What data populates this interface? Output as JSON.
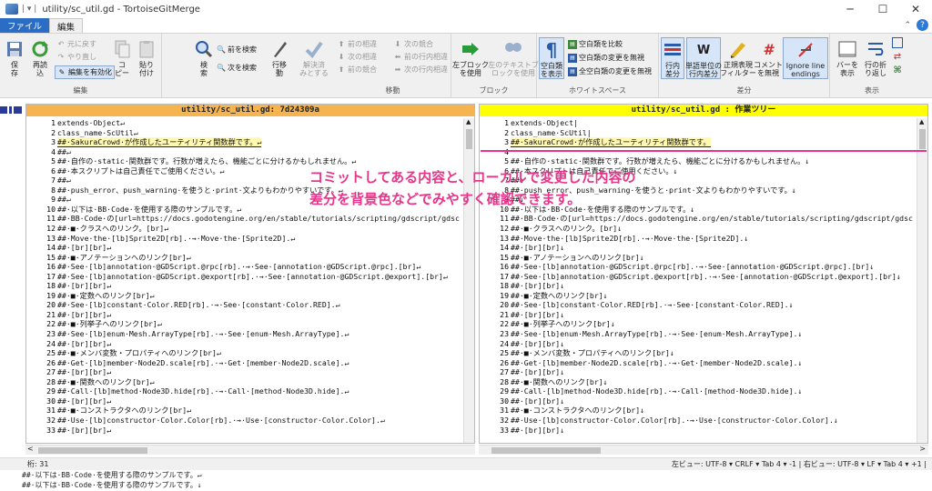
{
  "title": {
    "quick_access": "|  ▾ |",
    "text": "utility/sc_util.gd - TortoiseGitMerge"
  },
  "window_buttons": [
    "─",
    "☐",
    "✕"
  ],
  "tabs": {
    "file": "ファイル",
    "edit": "編集"
  },
  "ribbon": {
    "edit_group": {
      "label": "編集",
      "save": "保\n存",
      "reload": "再読\n込",
      "undo": "元に戻す",
      "redo": "やり直し",
      "enable_edit": "編集を有効化",
      "copy": "コ\nピー",
      "paste": "貼り\n付け"
    },
    "search_group": {
      "search": "検\n索",
      "find_prev": "前を検索",
      "find_next": "次を検索",
      "goto_line": "行移\n動",
      "resolve": "解決済\nみとする"
    },
    "move_group": {
      "label": "移動",
      "prev_diff": "前の相違",
      "next_diff": "次の相違",
      "prev_conflict_small": "前の競合",
      "prev_conflict": "前の競合",
      "next_conflict": "次の競合",
      "prev_inline": "前の行内相違",
      "next_inline": "次の行内相違"
    },
    "block_group": {
      "label": "ブロック",
      "use_left": "左ブロック\nを使用",
      "use_left_text": "左のテキストブ\nロックを使用"
    },
    "whitespace_group": {
      "label": "ホワイトスペース",
      "show_ws": "空白類\nを表示",
      "compare_ws": "空白類を比較",
      "ignore_ws_change": "空白類の変更を無視",
      "ignore_all_ws": "全空白類の変更を無視"
    },
    "diff_group": {
      "label": "差分",
      "line_diff": "行内\n差分",
      "word_diff": "単語単位の\n行内差分",
      "regex_filter": "正規表現\nフィルター",
      "ignore_comments": "コメント\nを無視",
      "ignore_line_endings": "Ignore line\nendings"
    },
    "view_group": {
      "label": "表示",
      "bars": "バーを\n表示",
      "wrap": "行の折\nり返し"
    }
  },
  "left_pane": {
    "header": "utility/sc_util.gd: 7d24309a",
    "header_color": "#f5b450",
    "lines": [
      {
        "n": "1",
        "t": "extends·Object↵"
      },
      {
        "n": "2",
        "t": "class_name·ScUtil↵"
      },
      {
        "n": "3",
        "t": "##·SakuraCrowd·が作成したユーティリティ関数群です。↵",
        "hl": true
      },
      {
        "n": "4",
        "t": "##↵"
      },
      {
        "n": "5",
        "t": "##·自作の·static·関数群です。行数が増えたら、機能ごとに分けるかもしれません。↵"
      },
      {
        "n": "6",
        "t": "##·本スクリプトは自己責任でご使用ください。↵"
      },
      {
        "n": "7",
        "t": "##↵"
      },
      {
        "n": "8",
        "t": "##·push_error、push_warning·を使うと·print·文よりもわかりやすいです。↵"
      },
      {
        "n": "9",
        "t": "##↵"
      },
      {
        "n": "10",
        "t": "##·以下は·BB·Code·を使用する際のサンプルです。↵"
      },
      {
        "n": "11",
        "t": "##·BB·Code·の[url=https://docs.godotengine.org/en/stable/tutorials/scripting/gdscript/gdsc"
      },
      {
        "n": "12",
        "t": "##·■·クラスへのリンク。[br]↵"
      },
      {
        "n": "13",
        "t": "##·Move·the·[lb]Sprite2D[rb].·→·Move·the·[Sprite2D].↵"
      },
      {
        "n": "14",
        "t": "##·[br][br]↵"
      },
      {
        "n": "15",
        "t": "##·■·アノテーションへのリンク[br]↵"
      },
      {
        "n": "16",
        "t": "##·See·[lb]annotation·@GDScript.@rpc[rb].·→·See·[annotation·@GDScript.@rpc].[br]↵"
      },
      {
        "n": "17",
        "t": "##·See·[lb]annotation·@GDScript.@export[rb].·→·See·[annotation·@GDScript.@export].[br]↵"
      },
      {
        "n": "18",
        "t": "##·[br][br]↵"
      },
      {
        "n": "19",
        "t": "##·■·定数へのリンク[br]↵"
      },
      {
        "n": "20",
        "t": "##·See·[lb]constant·Color.RED[rb].·→·See·[constant·Color.RED].↵"
      },
      {
        "n": "21",
        "t": "##·[br][br]↵"
      },
      {
        "n": "22",
        "t": "##·■·列挙子へのリンク[br]↵"
      },
      {
        "n": "23",
        "t": "##·See·[lb]enum·Mesh.ArrayType[rb].·→·See·[enum·Mesh.ArrayType].↵"
      },
      {
        "n": "24",
        "t": "##·[br][br]↵"
      },
      {
        "n": "25",
        "t": "##·■·メンバ変数・プロパティへのリンク[br]↵"
      },
      {
        "n": "26",
        "t": "##·Get·[lb]member·Node2D.scale[rb].·→·Get·[member·Node2D.scale].↵"
      },
      {
        "n": "27",
        "t": "##·[br][br]↵"
      },
      {
        "n": "28",
        "t": "##·■·関数へのリンク[br]↵"
      },
      {
        "n": "29",
        "t": "##·Call·[lb]method·Node3D.hide[rb].·→·Call·[method·Node3D.hide].↵"
      },
      {
        "n": "30",
        "t": "##·[br][br]↵"
      },
      {
        "n": "31",
        "t": "##·■·コンストラクタへのリンク[br]↵"
      },
      {
        "n": "32",
        "t": "##·Use·[lb]constructor·Color.Color[rb].·→·Use·[constructor·Color.Color].↵"
      },
      {
        "n": "33",
        "t": "##·[br][br]↵"
      }
    ]
  },
  "right_pane": {
    "header": "utility/sc_util.gd : 作業ツリー",
    "header_color": "#ffff00",
    "lines": [
      {
        "n": "1",
        "t": "extends·Object|"
      },
      {
        "n": "2",
        "t": "class_name·ScUtil|"
      },
      {
        "n": "3",
        "t": "##·SakuraCrowd·が作成したユーティリティ関数群です。",
        "hl": true
      },
      {
        "n": "4",
        "t": ""
      },
      {
        "n": "5",
        "t": "##·自作の·static·関数群です。行数が増えたら、機能ごとに分けるかもしれません。↓"
      },
      {
        "n": "6",
        "t": "##·本スクリプトは自己責任でご使用ください。↓"
      },
      {
        "n": "7",
        "t": "##↓"
      },
      {
        "n": "8",
        "t": "##·push_error、push_warning·を使うと·print·文よりもわかりやすいです。↓"
      },
      {
        "n": "9",
        "t": "##↓"
      },
      {
        "n": "10",
        "t": "##·以下は·BB·Code·を使用する際のサンプルです。↓"
      },
      {
        "n": "11",
        "t": "##·BB·Code·の[url=https://docs.godotengine.org/en/stable/tutorials/scripting/gdscript/gdsc"
      },
      {
        "n": "12",
        "t": "##·■·クラスへのリンク。[br]↓"
      },
      {
        "n": "13",
        "t": "##·Move·the·[lb]Sprite2D[rb].·→·Move·the·[Sprite2D].↓"
      },
      {
        "n": "14",
        "t": "##·[br][br]↓"
      },
      {
        "n": "15",
        "t": "##·■·アノテーションへのリンク[br]↓"
      },
      {
        "n": "16",
        "t": "##·See·[lb]annotation·@GDScript.@rpc[rb].·→·See·[annotation·@GDScript.@rpc].[br]↓"
      },
      {
        "n": "17",
        "t": "##·See·[lb]annotation·@GDScript.@export[rb].·→·See·[annotation·@GDScript.@export].[br]↓"
      },
      {
        "n": "18",
        "t": "##·[br][br]↓"
      },
      {
        "n": "19",
        "t": "##·■·定数へのリンク[br]↓"
      },
      {
        "n": "20",
        "t": "##·See·[lb]constant·Color.RED[rb].·→·See·[constant·Color.RED].↓"
      },
      {
        "n": "21",
        "t": "##·[br][br]↓"
      },
      {
        "n": "22",
        "t": "##·■·列挙子へのリンク[br]↓"
      },
      {
        "n": "23",
        "t": "##·See·[lb]enum·Mesh.ArrayType[rb].·→·See·[enum·Mesh.ArrayType].↓"
      },
      {
        "n": "24",
        "t": "##·[br][br]↓"
      },
      {
        "n": "25",
        "t": "##·■·メンバ変数・プロパティへのリンク[br]↓"
      },
      {
        "n": "26",
        "t": "##·Get·[lb]member·Node2D.scale[rb].·→·Get·[member·Node2D.scale].↓"
      },
      {
        "n": "27",
        "t": "##·[br][br]↓"
      },
      {
        "n": "28",
        "t": "##·■·関数へのリンク[br]↓"
      },
      {
        "n": "29",
        "t": "##·Call·[lb]method·Node3D.hide[rb].·→·Call·[method·Node3D.hide].↓"
      },
      {
        "n": "30",
        "t": "##·[br][br]↓"
      },
      {
        "n": "31",
        "t": "##·■·コンストラクタへのリンク[br]↓"
      },
      {
        "n": "32",
        "t": "##·Use·[lb]constructor·Color.Color[rb].·→·Use·[constructor·Color.Color].↓"
      },
      {
        "n": "33",
        "t": "##·[br][br]↓"
      }
    ]
  },
  "overlay": {
    "line1": "コミットしてある内容と、ローカルで変更した内容の",
    "line2": "差分を背景色などでみやすく確認できます。",
    "color": "#e8358a"
  },
  "status": {
    "col": "桁: 31",
    "left_view": "左ビュー:  UTF-8 ▾  CRLF ▾  Tab 4 ▾  -1  |  右ビュー:  UTF-8 ▾  LF ▾  Tab 4 ▾  +1  |"
  },
  "bottom": {
    "line1": "##·以下は·BB·Code·を使用する際のサンプルです。↵",
    "line2": "##·以下は·BB·Code·を使用する際のサンプルです。↓"
  }
}
